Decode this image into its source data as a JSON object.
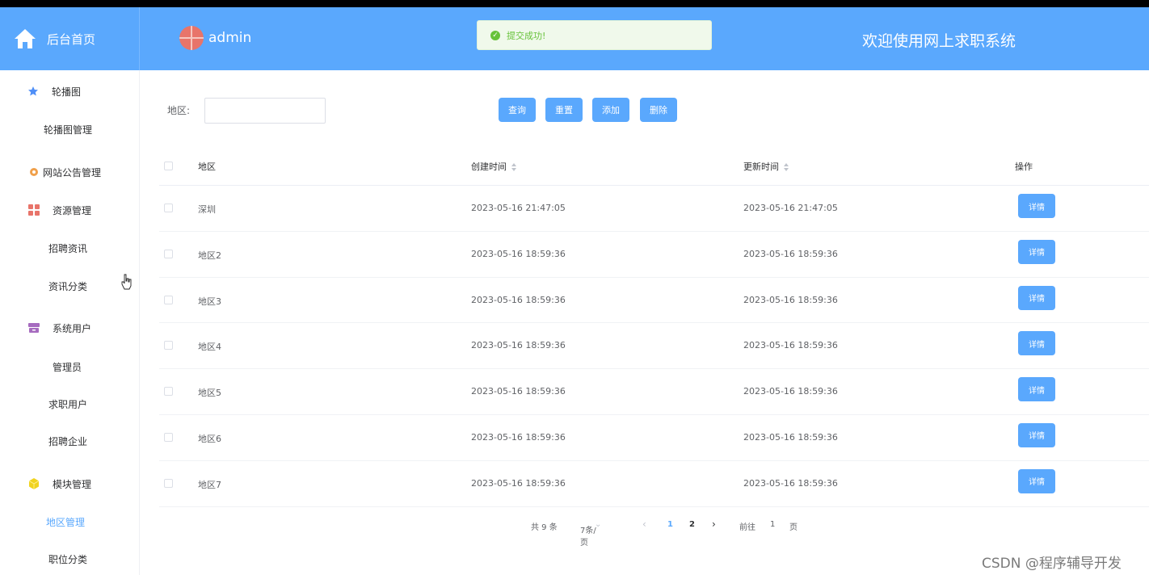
{
  "header": {
    "brand": "后台首页",
    "username": "admin",
    "welcome": "欢迎使用网上求职系统"
  },
  "toast": {
    "message": "提交成功!"
  },
  "sidebar": {
    "items": [
      {
        "label": "轮播图",
        "icon": "star-icon"
      },
      {
        "label": "轮播图管理"
      },
      {
        "label": "网站公告管理",
        "icon": "gear-icon"
      },
      {
        "label": "资源管理",
        "icon": "grid-icon"
      },
      {
        "label": "招聘资讯"
      },
      {
        "label": "资讯分类"
      },
      {
        "label": "系统用户",
        "icon": "archive-icon"
      },
      {
        "label": "管理员"
      },
      {
        "label": "求职用户"
      },
      {
        "label": "招聘企业"
      },
      {
        "label": "模块管理",
        "icon": "cube-icon"
      },
      {
        "label": "地区管理"
      },
      {
        "label": "职位分类"
      }
    ]
  },
  "filter": {
    "label": "地区:",
    "value": ""
  },
  "toolbar": {
    "query": "查询",
    "reset": "重置",
    "add": "添加",
    "delete": "删除"
  },
  "table": {
    "columns": {
      "region": "地区",
      "created": "创建时间",
      "updated": "更新时间",
      "actions": "操作"
    },
    "rows": [
      {
        "region": "深圳",
        "created": "2023-05-16 21:47:05",
        "updated": "2023-05-16 21:47:05",
        "action": "详情"
      },
      {
        "region": "地区2",
        "created": "2023-05-16 18:59:36",
        "updated": "2023-05-16 18:59:36",
        "action": "详情"
      },
      {
        "region": "地区3",
        "created": "2023-05-16 18:59:36",
        "updated": "2023-05-16 18:59:36",
        "action": "详情"
      },
      {
        "region": "地区4",
        "created": "2023-05-16 18:59:36",
        "updated": "2023-05-16 18:59:36",
        "action": "详情"
      },
      {
        "region": "地区5",
        "created": "2023-05-16 18:59:36",
        "updated": "2023-05-16 18:59:36",
        "action": "详情"
      },
      {
        "region": "地区6",
        "created": "2023-05-16 18:59:36",
        "updated": "2023-05-16 18:59:36",
        "action": "详情"
      },
      {
        "region": "地区7",
        "created": "2023-05-16 18:59:36",
        "updated": "2023-05-16 18:59:36",
        "action": "详情"
      }
    ]
  },
  "pagination": {
    "total": "共 9 条",
    "page_size": "7条/页",
    "pages": [
      "1",
      "2"
    ],
    "goto_label": "前往",
    "goto_value": "1",
    "goto_suffix": "页"
  },
  "watermark": "CSDN @程序辅导开发",
  "colors": {
    "primary": "#5aa8fd",
    "success": "#67c23a"
  }
}
